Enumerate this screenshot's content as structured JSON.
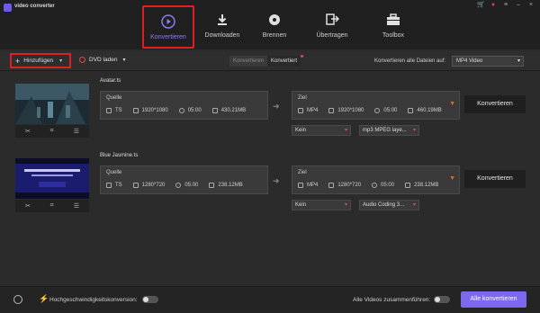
{
  "app": {
    "title": "video converter"
  },
  "nav": {
    "tabs": [
      {
        "label": "Konvertieren",
        "icon": "play-circle-icon",
        "active": true
      },
      {
        "label": "Downloaden",
        "icon": "download-icon"
      },
      {
        "label": "Brennen",
        "icon": "disc-burn-icon"
      },
      {
        "label": "Übertragen",
        "icon": "transfer-icon"
      },
      {
        "label": "Toolbox",
        "icon": "toolbox-icon"
      }
    ]
  },
  "toolbar": {
    "add_label": "Hinzufügen",
    "dvd_label": "DVD laden",
    "seg_converting": "Konvertieren",
    "seg_converted": "Konvertiert",
    "convert_all_to_label": "Konvertieren alle Dateien auf:",
    "convert_all_to_value": "MP4 Video"
  },
  "items": [
    {
      "filename": "Avatar.ts",
      "source": {
        "header": "Quelle",
        "format": "TS",
        "resolution": "1920*1080",
        "duration": "05:00",
        "size": "430.21MB"
      },
      "target": {
        "header": "Ziel",
        "format": "MP4",
        "resolution": "1920*1080",
        "duration": "05:00",
        "size": "460.19MB"
      },
      "subtitle": "Kein",
      "audio": "mp3 MPEG laye...",
      "convert_label": "Konvertieren"
    },
    {
      "filename": "Blue Jasmine.ts",
      "source": {
        "header": "Quelle",
        "format": "TS",
        "resolution": "1280*720",
        "duration": "05:00",
        "size": "238.12MB"
      },
      "target": {
        "header": "Ziel",
        "format": "MP4",
        "resolution": "1280*720",
        "duration": "05:00",
        "size": "238.12MB"
      },
      "subtitle": "Kein",
      "audio": "Audio Coding 3...",
      "convert_label": "Konvertieren"
    }
  ],
  "bottom": {
    "speed_label": "Hochgeschwindigkeitskonversion:",
    "merge_label": "Alle Videos zusammenführen:",
    "convert_all_label": "Alle konvertieren"
  },
  "colors": {
    "accent": "#7b68ee",
    "highlight": "#e02020",
    "bg": "#2b2b2b"
  }
}
